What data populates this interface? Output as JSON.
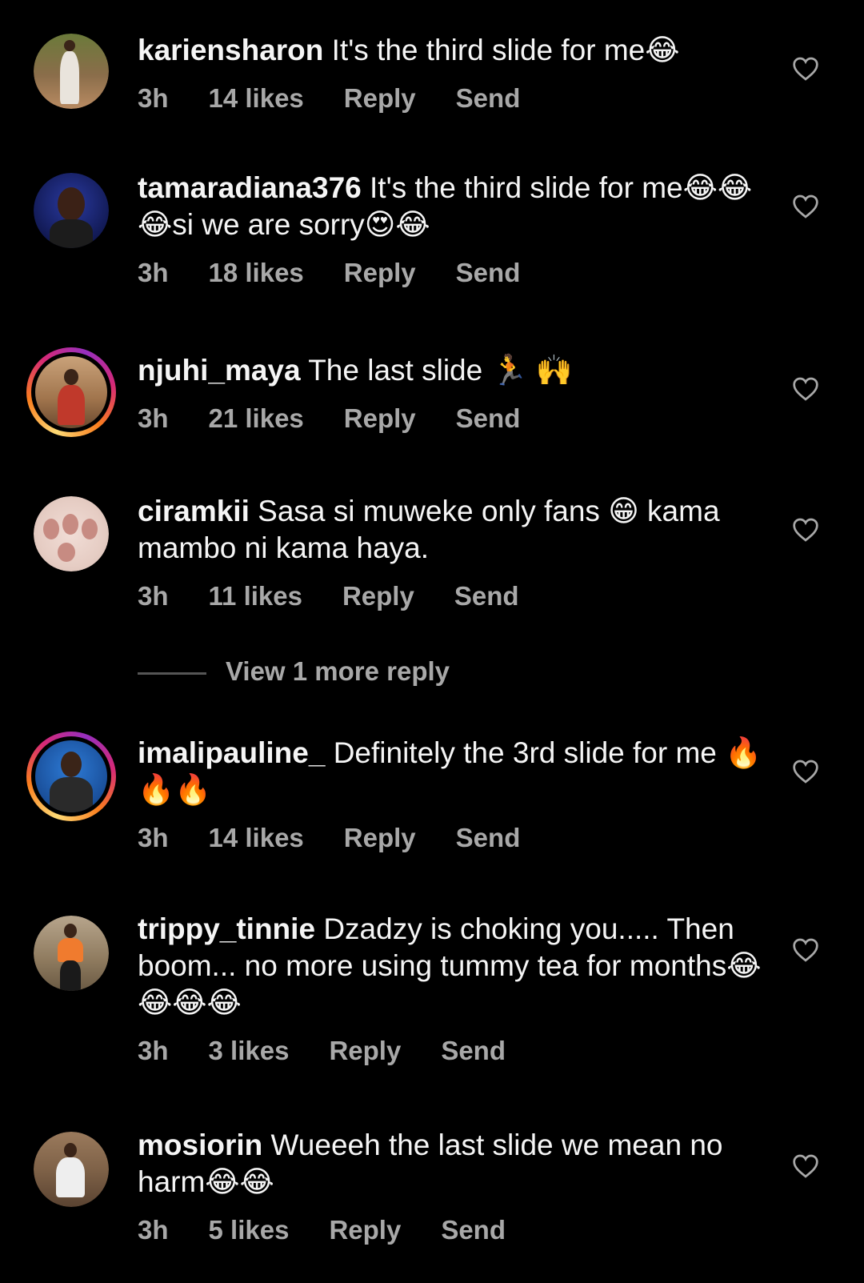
{
  "comments": [
    {
      "username": "kariensharon",
      "text": "It's the third slide for me😂",
      "time": "3h",
      "likes": "14 likes",
      "reply": "Reply",
      "send": "Send",
      "avatar_ring": false
    },
    {
      "username": "tamaradiana376",
      "text": "It's the third slide for me😂😂😂si we are sorry😍😂",
      "time": "3h",
      "likes": "18 likes",
      "reply": "Reply",
      "send": "Send",
      "avatar_ring": false
    },
    {
      "username": "njuhi_maya",
      "text": "The last slide 🏃 🙌",
      "time": "3h",
      "likes": "21 likes",
      "reply": "Reply",
      "send": "Send",
      "avatar_ring": true
    },
    {
      "username": "ciramkii",
      "text": "Sasa si muweke only fans 😁 kama mambo ni kama haya.",
      "time": "3h",
      "likes": "11 likes",
      "reply": "Reply",
      "send": "Send",
      "avatar_ring": false
    },
    {
      "username": "imalipauline_",
      "text": "Definitely the 3rd slide for me 🔥🔥🔥",
      "time": "3h",
      "likes": "14 likes",
      "reply": "Reply",
      "send": "Send",
      "avatar_ring": true
    },
    {
      "username": "trippy_tinnie",
      "text": "Dzadzy is choking you..... Then  boom... no more using tummy tea for months😂😂😂😂",
      "time": "3h",
      "likes": "3 likes",
      "reply": "Reply",
      "send": "Send",
      "avatar_ring": false
    },
    {
      "username": "mosiorin",
      "text": "Wueeeh the last slide we mean no harm😂😂",
      "time": "3h",
      "likes": "5 likes",
      "reply": "Reply",
      "send": "Send",
      "avatar_ring": false
    }
  ],
  "view_more_replies": "View 1 more reply",
  "icons": {
    "like": "heart-outline-icon"
  },
  "colors": {
    "background": "#000000",
    "primary_text": "#f5f5f5",
    "secondary_text": "#a8a8a8"
  }
}
